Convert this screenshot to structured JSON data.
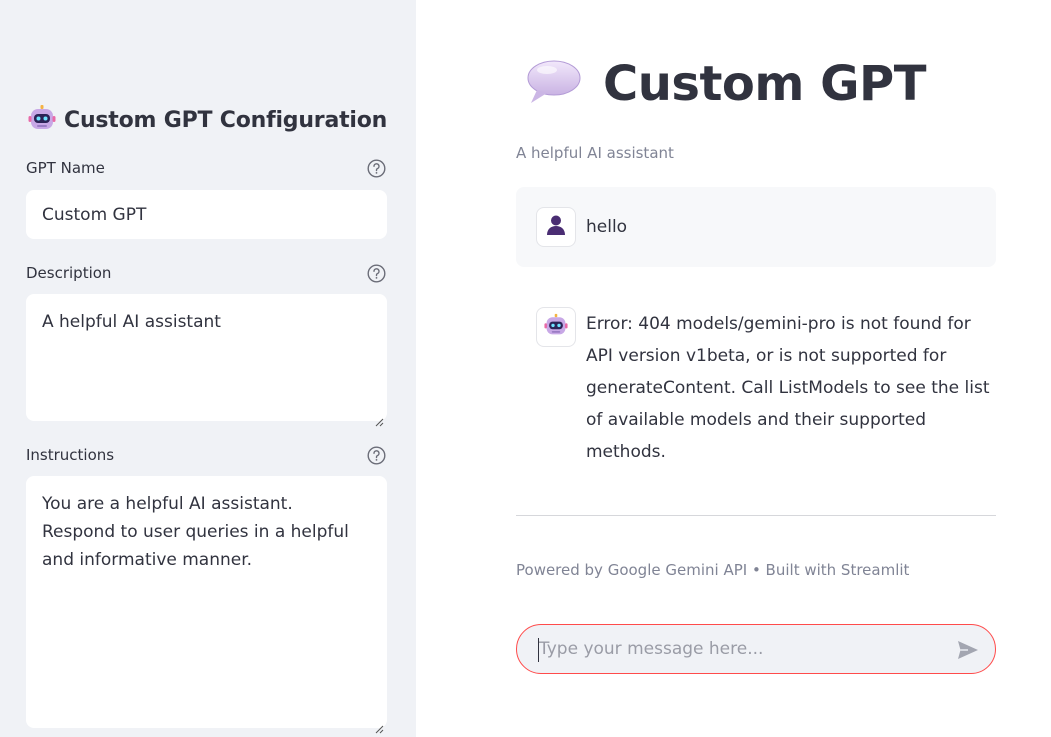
{
  "sidebar": {
    "title": "Custom GPT Configuration",
    "title_icon": "robot-icon",
    "fields": {
      "name": {
        "label": "GPT Name",
        "value": "Custom GPT"
      },
      "description": {
        "label": "Description",
        "value": "A helpful AI assistant"
      },
      "instructions": {
        "label": "Instructions",
        "value": "You are a helpful AI assistant. Respond to user queries in a helpful and informative manner."
      }
    }
  },
  "main": {
    "title": "Custom GPT",
    "title_icon": "speech-bubble-icon",
    "caption": "A helpful AI assistant",
    "messages": [
      {
        "role": "user",
        "avatar_icon": "user-icon",
        "text": "hello"
      },
      {
        "role": "assistant",
        "avatar_icon": "robot-icon",
        "text": "Error: 404 models/gemini-pro is not found for API version v1beta, or is not supported for generateContent. Call ListModels to see the list of available models and their supported methods."
      }
    ],
    "footer": "Powered by Google Gemini API • Built with Streamlit",
    "chat_input": {
      "placeholder": "Type your message here...",
      "value": ""
    }
  },
  "colors": {
    "sidebar_bg": "#f0f2f6",
    "text": "#31333f",
    "muted": "#808495",
    "accent": "#ff4b4b",
    "user_avatar": "#4a2d73"
  }
}
